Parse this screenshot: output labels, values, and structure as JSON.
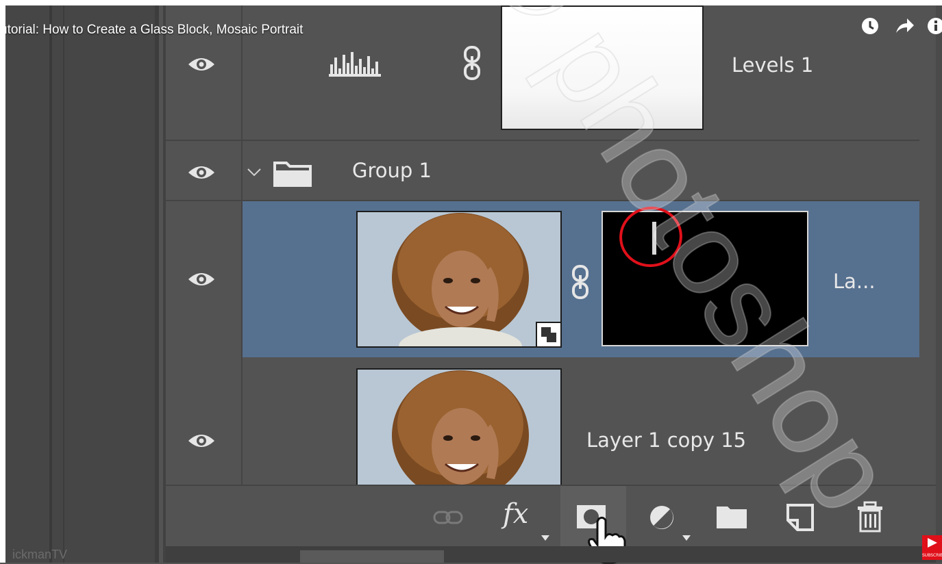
{
  "video": {
    "title": "utorial: How to Create a Glass Block, Mosaic Portrait",
    "icons": [
      "watch-later-icon",
      "share-icon",
      "info-icon"
    ],
    "channel_watermark": "ickmanTV",
    "subscribe_badge": "SUBSCRIBE"
  },
  "layers": [
    {
      "name": "Levels 1",
      "kind": "adjustment-levels",
      "visible": true,
      "thumbnail": "white-gradient"
    },
    {
      "name": "Group 1",
      "kind": "group",
      "visible": true,
      "expanded": true
    },
    {
      "name": "La...",
      "kind": "smart-object-with-mask",
      "visible": true,
      "selected": true,
      "annotation": "red-circle-on-mask"
    },
    {
      "name": "Layer 1 copy 15",
      "kind": "smart-object",
      "visible": true
    }
  ],
  "toolbar": {
    "buttons": [
      "link-layers-icon",
      "fx-icon",
      "add-mask-icon",
      "adjustment-layer-icon",
      "new-group-icon",
      "new-layer-icon",
      "delete-layer-icon"
    ],
    "fx_label": "fx",
    "hovered": "add-mask-icon"
  },
  "watermark_text": "© photoshop",
  "colors": {
    "panel_bg": "#535353",
    "selected_row": "#56708f",
    "annotation": "#e0101a"
  }
}
